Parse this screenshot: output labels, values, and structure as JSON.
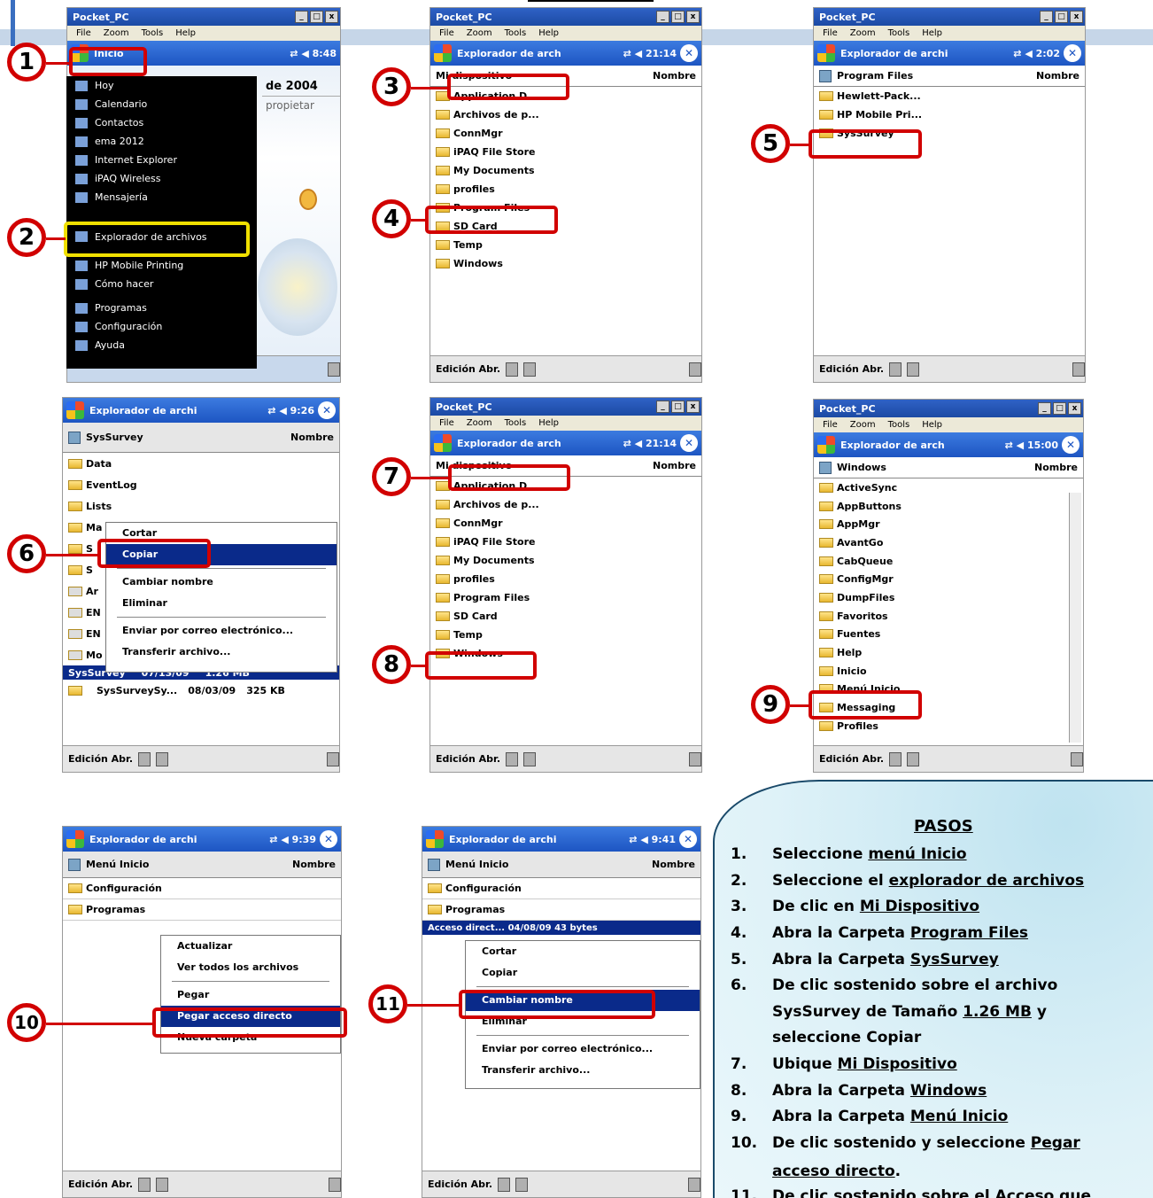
{
  "window_title": "Pocket_PC",
  "menus": [
    "File",
    "Zoom",
    "Tools",
    "Help"
  ],
  "bottom_bar": "Edición Abr.",
  "sort_label": "Nombre",
  "screen1": {
    "title": "Inicio",
    "status": "⇄ ◀ 8:48",
    "date": "de 2004",
    "prop": "propietar",
    "items": [
      "Hoy",
      "Calendario",
      "Contactos",
      "ema 2012",
      "Internet Explorer",
      "iPAQ Wireless",
      "Mensajería",
      "Explorador de archivos",
      "HP Mobile Printing",
      "Cómo hacer",
      "Programas",
      "Configuración",
      "Ayuda"
    ]
  },
  "screen3": {
    "title": "Explorador de arch",
    "status": "⇄ ◀ 21:14",
    "crumb": "Mi dispositivo",
    "rows": [
      "Application D...",
      "Archivos de p...",
      "ConnMgr",
      "iPAQ File Store",
      "My Documents",
      "profiles",
      "Program Files",
      "SD Card",
      "Temp",
      "Windows"
    ]
  },
  "screen5": {
    "title": "Explorador de archi",
    "status": "⇄ ◀ 2:02",
    "crumb": "Program Files",
    "rows": [
      "Hewlett-Pack...",
      "HP Mobile Pri...",
      "SysSurvey"
    ]
  },
  "screen6": {
    "title": "Explorador de archi",
    "status": "⇄ ◀ 9:26",
    "crumb": "SysSurvey",
    "rows": [
      "Data",
      "EventLog",
      "Lists",
      "Ma",
      "S",
      "S",
      "Ar",
      "EN",
      "EN",
      "Mo"
    ],
    "sel_row": [
      "SysSurvey",
      "07/13/09",
      "1.26 MB"
    ],
    "last_row": [
      "SysSurveySy...",
      "08/03/09",
      "325 KB"
    ],
    "menu": [
      "Cortar",
      "Copiar",
      "Cambiar nombre",
      "Eliminar",
      "Enviar por correo electrónico...",
      "Transferir archivo..."
    ]
  },
  "screen7": {
    "title": "Explorador de arch",
    "status": "⇄ ◀ 21:14",
    "crumb": "Mi dispositivo",
    "rows": [
      "Application D...",
      "Archivos de p...",
      "ConnMgr",
      "iPAQ File Store",
      "My Documents",
      "profiles",
      "Program Files",
      "SD Card",
      "Temp",
      "Windows"
    ]
  },
  "screen9": {
    "title": "Explorador de arch",
    "status": "⇄ ◀ 15:00",
    "crumb": "Windows",
    "rows": [
      "ActiveSync",
      "AppButtons",
      "AppMgr",
      "AvantGo",
      "CabQueue",
      "ConfigMgr",
      "DumpFiles",
      "Favoritos",
      "Fuentes",
      "Help",
      "Inicio",
      "Menú Inicio",
      "Messaging",
      "Profiles"
    ]
  },
  "screen10": {
    "title": "Explorador de archi",
    "status": "⇄ ◀ 9:39",
    "crumb": "Menú Inicio",
    "rows": [
      "Configuración",
      "Programas"
    ],
    "menu": [
      "Actualizar",
      "Ver todos los archivos",
      "Pegar",
      "Pegar acceso directo",
      "Nueva carpeta"
    ]
  },
  "screen11": {
    "title": "Explorador de archi",
    "status": "⇄ ◀ 9:41",
    "crumb": "Menú Inicio",
    "rows": [
      "Configuración",
      "Programas"
    ],
    "sel_row": "Acceso direct...   04/08/09   43 bytes",
    "menu": [
      "Cortar",
      "Copiar",
      "Cambiar nombre",
      "Eliminar",
      "Enviar por correo electrónico...",
      "Transferir archivo..."
    ]
  },
  "markers": [
    "1",
    "2",
    "3",
    "4",
    "5",
    "6",
    "7",
    "8",
    "9",
    "10",
    "11"
  ],
  "steps": {
    "title": "PASOS",
    "items": [
      {
        "n": "1.",
        "pre": "Seleccione ",
        "u": "menú Inicio",
        "post": ""
      },
      {
        "n": "2.",
        "pre": "Seleccione el ",
        "u": "explorador de archivos",
        "post": ""
      },
      {
        "n": "3.",
        "pre": "De clic en ",
        "u": "Mi Dispositivo",
        "post": ""
      },
      {
        "n": "4.",
        "pre": "Abra la Carpeta ",
        "u": "Program Files",
        "post": ""
      },
      {
        "n": "5.",
        "pre": "Abra la Carpeta ",
        "u": "SysSurvey",
        "post": ""
      },
      {
        "n": "6.",
        "pre": "De clic sostenido sobre el archivo",
        "u": "",
        "post": ""
      },
      {
        "n": "",
        "pre": "SysSurvey de Tamaño ",
        "u": "1.26 MB",
        "post": " y"
      },
      {
        "n": "",
        "pre": "seleccione Copiar",
        "u": "",
        "post": ""
      },
      {
        "n": "7.",
        "pre": "Ubique ",
        "u": "Mi Dispositivo",
        "post": ""
      },
      {
        "n": "8.",
        "pre": "Abra la Carpeta ",
        "u": "Windows",
        "post": ""
      },
      {
        "n": "9.",
        "pre": "Abra la Carpeta ",
        "u": "Menú Inicio",
        "post": ""
      },
      {
        "n": "10.",
        "pre": "De clic sostenido y seleccione ",
        "u": "Pegar",
        "post": ""
      },
      {
        "n": "",
        "pre": "",
        "u": "acceso directo",
        "post": "."
      },
      {
        "n": "11.",
        "pre": "De clic sostenido sobre el Acceso que",
        "u": "",
        "post": ""
      }
    ]
  }
}
